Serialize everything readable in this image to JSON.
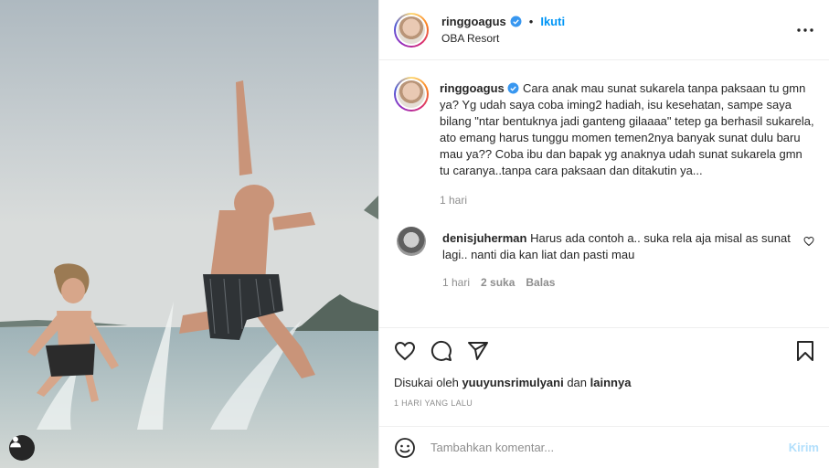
{
  "post": {
    "username": "ringgoagus",
    "follow_label": "Ikuti",
    "separator": "•",
    "location": "OBA Resort",
    "caption": "Cara anak mau sunat sukarela tanpa paksaan tu gmn ya? Yg udah saya coba iming2 hadiah, isu kesehatan, sampe saya bilang \"ntar bentuknya jadi ganteng gilaaaa\" tetep ga berhasil sukarela, ato emang harus tunggu momen temen2nya banyak sunat dulu baru mau ya?? Coba ibu dan bapak yg anaknya udah sunat sukarela gmn tu caranya..tanpa cara paksaan dan ditakutin ya...",
    "caption_time": "1 hari"
  },
  "comments": [
    {
      "username": "denisjuherman",
      "text": "Harus ada contoh a.. suka rela aja misal as sunat lagi.. nanti dia kan liat dan pasti mau",
      "time": "1 hari",
      "likes": "2 suka",
      "reply_label": "Balas"
    }
  ],
  "likes": {
    "prefix": "Disukai oleh",
    "user": "yuuyunsrimulyani",
    "connector": "dan",
    "others": "lainnya"
  },
  "date_label": "1 HARI YANG LALU",
  "add_comment": {
    "placeholder": "Tambahkan komentar...",
    "post_label": "Kirim"
  },
  "icons": {
    "more": "more-horizontal-icon",
    "like": "heart-icon",
    "comment": "comment-icon",
    "share": "paper-plane-icon",
    "save": "bookmark-icon",
    "emoji": "emoji-icon",
    "user_tag": "user-tag-icon",
    "verified": "verified-badge-icon"
  },
  "colors": {
    "accent": "#0095f6",
    "verified": "#3897f0",
    "muted": "#8e8e8e",
    "post_disabled": "#b2dffc"
  }
}
